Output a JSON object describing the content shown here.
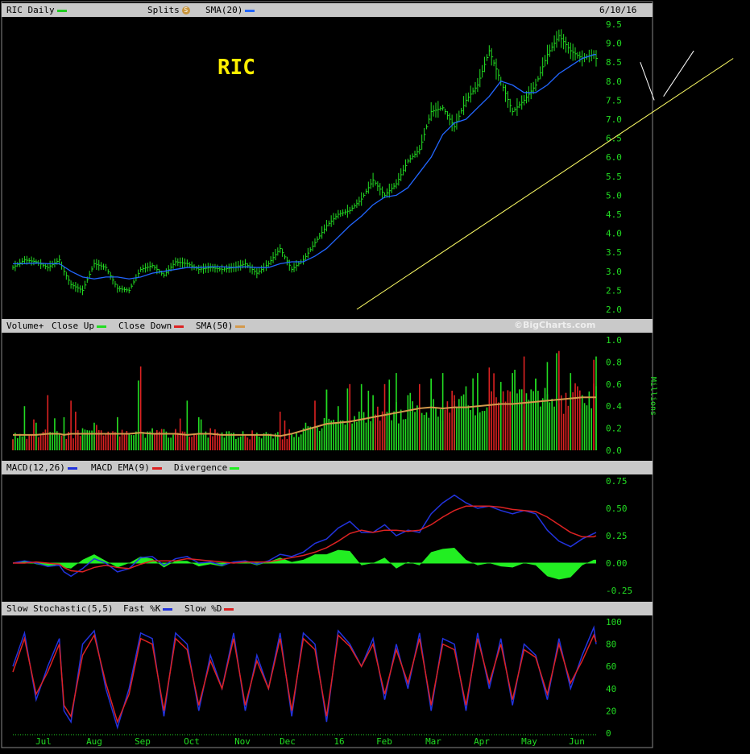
{
  "header": {
    "price_label": "RIC Daily",
    "splits_label": "Splits",
    "splits_icon": "S",
    "sma_label": "SMA(20)",
    "date": "6/10/16",
    "price_line_color": "#22cc22",
    "sma_color": "#2266ff"
  },
  "volume_header": {
    "label": "Volume+",
    "close_up_label": "Close Up",
    "close_down_label": "Close Down",
    "sma_label": "SMA(50)",
    "copyright": "©BigCharts.com",
    "up_color": "#22dd22",
    "down_color": "#dd2222",
    "sma_color": "#d49a4c"
  },
  "macd_header": {
    "label": "MACD(12,26)",
    "ema_label": "MACD EMA(9)",
    "divergence_label": "Divergence",
    "macd_color": "#2233dd",
    "ema_color": "#dd2222",
    "div_color": "#22ee22"
  },
  "stoch_header": {
    "label": "Slow Stochastic(5,5)",
    "fast_label": "Fast %K",
    "slow_label": "Slow %D",
    "fast_color": "#2233dd",
    "slow_color": "#dd2222"
  },
  "chart_data": [
    {
      "type": "line",
      "panel": "price",
      "title": "RIC",
      "ylim": [
        2.0,
        9.5
      ],
      "yticks": [
        "2.0",
        "2.5",
        "3.0",
        "3.5",
        "4.0",
        "4.5",
        "5.0",
        "5.5",
        "6.0",
        "6.5",
        "7.0",
        "7.5",
        "8.0",
        "8.5",
        "9.0",
        "9.5"
      ],
      "months": [
        "Jul",
        "Aug",
        "Sep",
        "Oct",
        "Nov",
        "Dec",
        "16",
        "Feb",
        "Mar",
        "Apr",
        "May",
        "Jun"
      ],
      "x": [
        0,
        5,
        10,
        15,
        20,
        22,
        25,
        30,
        35,
        40,
        45,
        50,
        55,
        60,
        65,
        70,
        75,
        80,
        85,
        90,
        95,
        100,
        105,
        110,
        115,
        120,
        125,
        130,
        135,
        140,
        145,
        150,
        155,
        160,
        165,
        170,
        175,
        180,
        185,
        190,
        195,
        200,
        205,
        210,
        215,
        220,
        225,
        230,
        235,
        240,
        245,
        250,
        251
      ],
      "series": [
        {
          "values": [
            3.1,
            3.3,
            3.25,
            3.1,
            3.3,
            3.0,
            2.65,
            2.5,
            3.2,
            3.1,
            2.55,
            2.5,
            3.05,
            3.15,
            2.9,
            3.25,
            3.2,
            3.05,
            3.1,
            3.05,
            3.1,
            3.2,
            2.95,
            3.2,
            3.6,
            3.05,
            3.3,
            3.75,
            4.2,
            4.5,
            4.6,
            4.9,
            5.4,
            5.0,
            5.3,
            5.9,
            6.2,
            7.2,
            7.3,
            6.8,
            7.5,
            7.9,
            8.8,
            8.0,
            7.2,
            7.5,
            7.9,
            8.7,
            9.2,
            8.8,
            8.6,
            8.7,
            8.6
          ]
        },
        {
          "name": "SMA(20)",
          "values": [
            3.2,
            3.2,
            3.22,
            3.2,
            3.2,
            3.12,
            3.0,
            2.85,
            2.8,
            2.85,
            2.85,
            2.8,
            2.85,
            2.95,
            3.0,
            3.05,
            3.1,
            3.1,
            3.12,
            3.12,
            3.1,
            3.12,
            3.1,
            3.1,
            3.2,
            3.25,
            3.25,
            3.4,
            3.6,
            3.9,
            4.2,
            4.45,
            4.75,
            4.95,
            5.0,
            5.2,
            5.6,
            6.0,
            6.6,
            6.9,
            7.0,
            7.3,
            7.6,
            8.0,
            7.9,
            7.7,
            7.7,
            7.9,
            8.2,
            8.4,
            8.6,
            8.7,
            8.7
          ]
        }
      ],
      "trendlines": [
        {
          "start": [
            148,
            2.0
          ],
          "end": [
            310,
            8.6
          ]
        },
        {
          "start": [
            280,
            7.6
          ],
          "end": [
            293,
            8.8
          ]
        },
        {
          "start": [
            270,
            8.5
          ],
          "end": [
            276,
            7.5
          ]
        }
      ]
    },
    {
      "type": "bar",
      "panel": "volume",
      "ylabel": "Millions",
      "ylim": [
        0.0,
        1.0
      ],
      "yticks": [
        "0.0",
        "0.2",
        "0.4",
        "0.6",
        "0.8",
        "1.0"
      ],
      "x": [
        0,
        5,
        10,
        15,
        20,
        22,
        25,
        30,
        35,
        40,
        45,
        50,
        55,
        60,
        65,
        70,
        75,
        80,
        85,
        90,
        95,
        100,
        105,
        110,
        115,
        120,
        125,
        130,
        135,
        140,
        145,
        150,
        155,
        160,
        165,
        170,
        175,
        180,
        185,
        190,
        195,
        200,
        205,
        210,
        215,
        220,
        225,
        230,
        235,
        240,
        245,
        250,
        251
      ],
      "values": [
        0.1,
        0.4,
        0.25,
        0.5,
        0.15,
        0.3,
        0.45,
        0.2,
        0.25,
        0.15,
        0.3,
        0.12,
        0.76,
        0.2,
        0.15,
        0.18,
        0.45,
        0.3,
        0.2,
        0.12,
        0.15,
        0.14,
        0.16,
        0.15,
        0.35,
        0.15,
        0.2,
        0.45,
        0.55,
        0.4,
        0.6,
        0.6,
        0.5,
        0.6,
        0.7,
        0.5,
        0.6,
        0.65,
        0.7,
        0.5,
        0.58,
        0.7,
        0.75,
        0.62,
        0.7,
        0.85,
        0.65,
        0.8,
        0.9,
        0.7,
        0.5,
        0.82,
        0.85
      ],
      "series": [
        {
          "name": "SMA(50)",
          "values": [
            0.14,
            0.14,
            0.14,
            0.15,
            0.15,
            0.14,
            0.15,
            0.15,
            0.15,
            0.15,
            0.15,
            0.15,
            0.16,
            0.15,
            0.15,
            0.15,
            0.14,
            0.15,
            0.15,
            0.14,
            0.14,
            0.14,
            0.14,
            0.14,
            0.13,
            0.15,
            0.18,
            0.21,
            0.24,
            0.25,
            0.26,
            0.28,
            0.3,
            0.32,
            0.34,
            0.36,
            0.38,
            0.39,
            0.38,
            0.39,
            0.39,
            0.4,
            0.41,
            0.42,
            0.42,
            0.43,
            0.44,
            0.45,
            0.46,
            0.47,
            0.48,
            0.48,
            0.48
          ]
        }
      ]
    },
    {
      "type": "line",
      "panel": "macd",
      "ylim": [
        -0.25,
        0.75
      ],
      "yticks": [
        "-0.25",
        "0.00",
        "0.25",
        "0.50",
        "0.75"
      ],
      "x": [
        0,
        5,
        10,
        15,
        20,
        22,
        25,
        30,
        35,
        40,
        45,
        50,
        55,
        60,
        65,
        70,
        75,
        80,
        85,
        90,
        95,
        100,
        105,
        110,
        115,
        120,
        125,
        130,
        135,
        140,
        145,
        150,
        155,
        160,
        165,
        170,
        175,
        180,
        185,
        190,
        195,
        200,
        205,
        210,
        215,
        220,
        225,
        230,
        235,
        240,
        245,
        250,
        251
      ],
      "series": [
        {
          "name": "MACD(12,26)",
          "values": [
            0.0,
            0.02,
            0.0,
            -0.03,
            -0.02,
            -0.08,
            -0.12,
            -0.05,
            0.04,
            0.0,
            -0.08,
            -0.05,
            0.05,
            0.06,
            -0.02,
            0.04,
            0.06,
            0.0,
            0.01,
            -0.02,
            0.01,
            0.02,
            -0.01,
            0.02,
            0.08,
            0.06,
            0.1,
            0.18,
            0.22,
            0.32,
            0.38,
            0.28,
            0.28,
            0.35,
            0.25,
            0.3,
            0.28,
            0.45,
            0.55,
            0.62,
            0.55,
            0.5,
            0.52,
            0.48,
            0.45,
            0.48,
            0.45,
            0.3,
            0.2,
            0.15,
            0.22,
            0.27,
            0.28
          ]
        },
        {
          "name": "MACD EMA(9)",
          "values": [
            0.0,
            0.0,
            0.01,
            0.0,
            -0.01,
            -0.04,
            -0.07,
            -0.08,
            -0.04,
            -0.02,
            -0.04,
            -0.05,
            -0.01,
            0.02,
            0.02,
            0.02,
            0.04,
            0.03,
            0.02,
            0.01,
            0.0,
            0.01,
            0.01,
            0.01,
            0.03,
            0.05,
            0.07,
            0.1,
            0.14,
            0.2,
            0.27,
            0.3,
            0.28,
            0.3,
            0.3,
            0.29,
            0.3,
            0.35,
            0.42,
            0.48,
            0.52,
            0.52,
            0.52,
            0.51,
            0.49,
            0.48,
            0.47,
            0.42,
            0.35,
            0.28,
            0.24,
            0.24,
            0.25
          ]
        },
        {
          "name": "Divergence",
          "values": [
            0.0,
            0.02,
            -0.01,
            -0.03,
            -0.01,
            -0.04,
            -0.05,
            0.03,
            0.08,
            0.02,
            -0.04,
            0.0,
            0.06,
            0.04,
            -0.04,
            0.02,
            0.02,
            -0.03,
            -0.01,
            -0.03,
            0.01,
            0.01,
            -0.02,
            0.01,
            0.05,
            0.01,
            0.03,
            0.08,
            0.08,
            0.12,
            0.11,
            -0.02,
            0.0,
            0.05,
            -0.05,
            0.01,
            -0.02,
            0.1,
            0.13,
            0.14,
            0.03,
            -0.02,
            0.0,
            -0.03,
            -0.04,
            0.0,
            -0.02,
            -0.12,
            -0.15,
            -0.13,
            -0.02,
            0.03,
            0.03
          ]
        }
      ]
    },
    {
      "type": "line",
      "panel": "stochastic",
      "ylim": [
        0,
        100
      ],
      "yticks": [
        "0",
        "20",
        "40",
        "60",
        "80",
        "100"
      ],
      "months": [
        "Jul",
        "Aug",
        "Sep",
        "Oct",
        "Nov",
        "Dec",
        "16",
        "Feb",
        "Mar",
        "Apr",
        "May",
        "Jun"
      ],
      "x": [
        0,
        5,
        10,
        15,
        20,
        22,
        25,
        30,
        35,
        40,
        45,
        50,
        55,
        60,
        65,
        70,
        75,
        80,
        85,
        90,
        95,
        100,
        105,
        110,
        115,
        120,
        125,
        130,
        135,
        140,
        145,
        150,
        155,
        160,
        165,
        170,
        175,
        180,
        185,
        190,
        195,
        200,
        205,
        210,
        215,
        220,
        225,
        230,
        235,
        240,
        245,
        250,
        251
      ],
      "series": [
        {
          "name": "Fast %K",
          "values": [
            60,
            90,
            30,
            60,
            85,
            20,
            10,
            80,
            92,
            40,
            5,
            40,
            90,
            85,
            15,
            90,
            80,
            20,
            70,
            40,
            90,
            20,
            70,
            40,
            90,
            15,
            90,
            80,
            10,
            92,
            80,
            60,
            85,
            30,
            80,
            40,
            90,
            20,
            85,
            80,
            20,
            90,
            40,
            85,
            25,
            80,
            70,
            30,
            85,
            40,
            70,
            95,
            80
          ]
        },
        {
          "name": "Slow %D",
          "values": [
            55,
            85,
            35,
            55,
            80,
            25,
            15,
            70,
            88,
            45,
            10,
            35,
            85,
            80,
            20,
            85,
            75,
            25,
            65,
            40,
            85,
            25,
            65,
            40,
            85,
            20,
            85,
            75,
            15,
            88,
            78,
            60,
            80,
            35,
            75,
            45,
            85,
            25,
            80,
            75,
            25,
            85,
            45,
            80,
            30,
            75,
            68,
            35,
            80,
            45,
            65,
            88,
            82
          ]
        }
      ]
    }
  ]
}
